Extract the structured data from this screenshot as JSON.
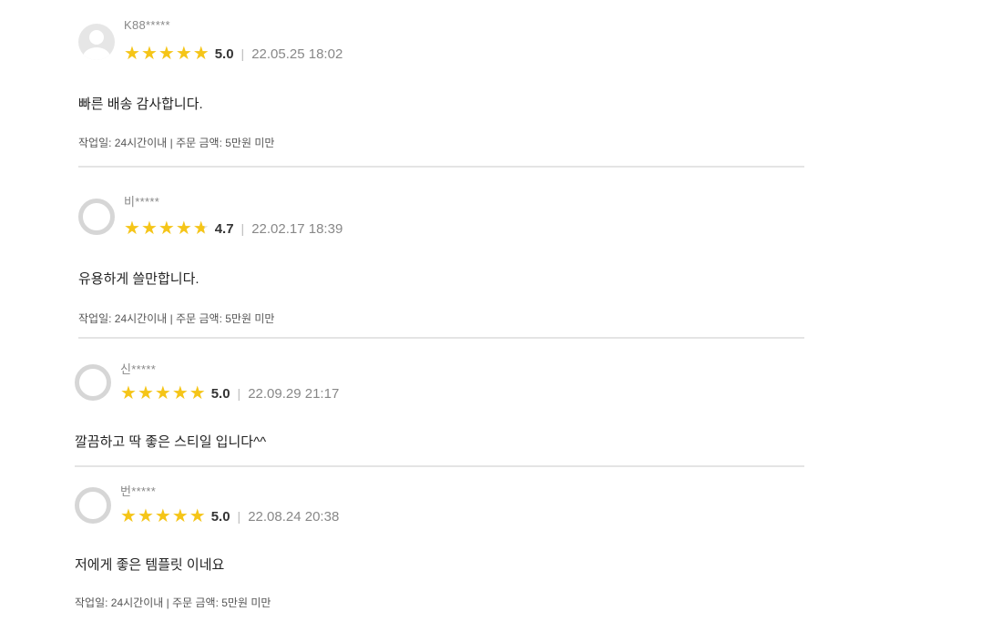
{
  "reviews": [
    {
      "name": "K88*****",
      "score": "5.0",
      "rating": 5.0,
      "separator": "|",
      "date": "22.05.25 18:02",
      "content": "빠른 배송 감사합니다.",
      "info": "작업일: 24시간이내 | 주문 금액: 5만원 미만"
    },
    {
      "name": "비*****",
      "score": "4.7",
      "rating": 4.7,
      "separator": "|",
      "date": "22.02.17 18:39",
      "content": "유용하게 쓸만합니다.",
      "info": "작업일: 24시간이내 | 주문 금액: 5만원 미만"
    },
    {
      "name": "신*****",
      "score": "5.0",
      "rating": 5.0,
      "separator": "|",
      "date": "22.09.29 21:17",
      "content": "깔끔하고 딱 좋은 스티일 입니다^^",
      "info": ""
    },
    {
      "name": "번*****",
      "score": "5.0",
      "rating": 5.0,
      "separator": "|",
      "date": "22.08.24 20:38",
      "content": "저에게 좋은 템플릿 이네요",
      "info": "작업일: 24시간이내 | 주문 금액: 5만원 미만"
    }
  ],
  "colors": {
    "star": "#f5c518",
    "divider": "#e4e4e4"
  },
  "icons": {
    "avatar": "user-avatar-icon",
    "star": "star-icon"
  }
}
